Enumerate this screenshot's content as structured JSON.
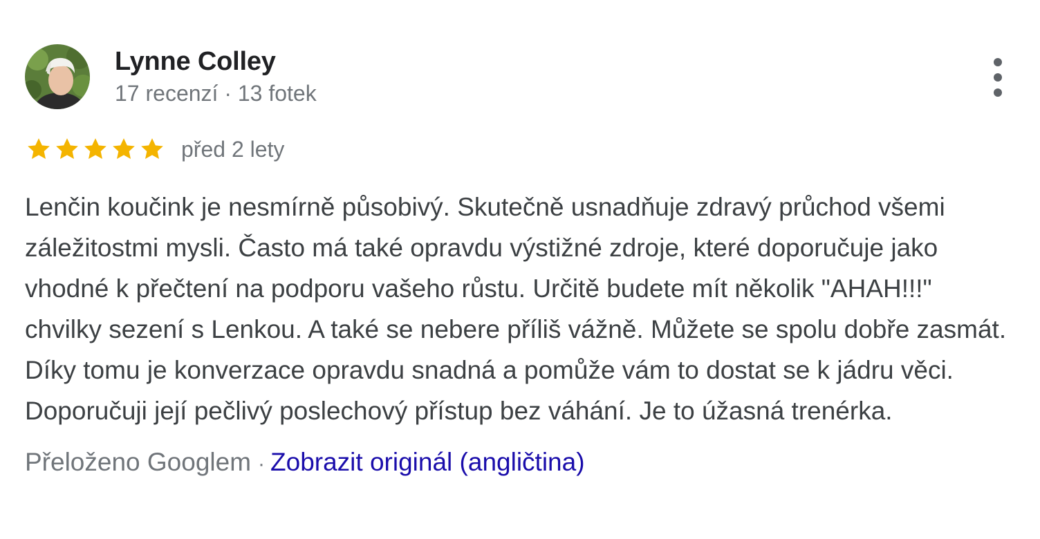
{
  "author": {
    "name": "Lynne Colley",
    "meta": "17 recenzí · 13 fotek"
  },
  "rating": {
    "stars": 5,
    "max": 5,
    "star_color": "#f4b400",
    "date": "před 2 lety"
  },
  "review": {
    "text": "Lenčin koučink je nesmírně působivý. Skutečně usnadňuje zdravý průchod všemi záležitostmi mysli. Často má také opravdu výstižné zdroje, které doporučuje jako vhodné k přečtení na podporu vašeho růstu. Určitě budete mít několik \"AHAH!!!\" chvilky sezení s Lenkou. A také se nebere příliš vážně. Můžete se spolu dobře zasmát. Díky tomu je konverzace opravdu snadná a pomůže vám to dostat se k jádru věci. Doporučuji její pečlivý poslechový přístup bez váhání. Je to úžasná trenérka."
  },
  "translation": {
    "label": "Přeloženo Googlem",
    "separator": "·",
    "link_label": "Zobrazit originál (angličtina)"
  },
  "colors": {
    "link": "#1a0dab",
    "secondary_text": "#70757a",
    "body_text": "#3c4043"
  },
  "icons": {
    "menu": "more-vert-icon",
    "star": "star-icon"
  }
}
